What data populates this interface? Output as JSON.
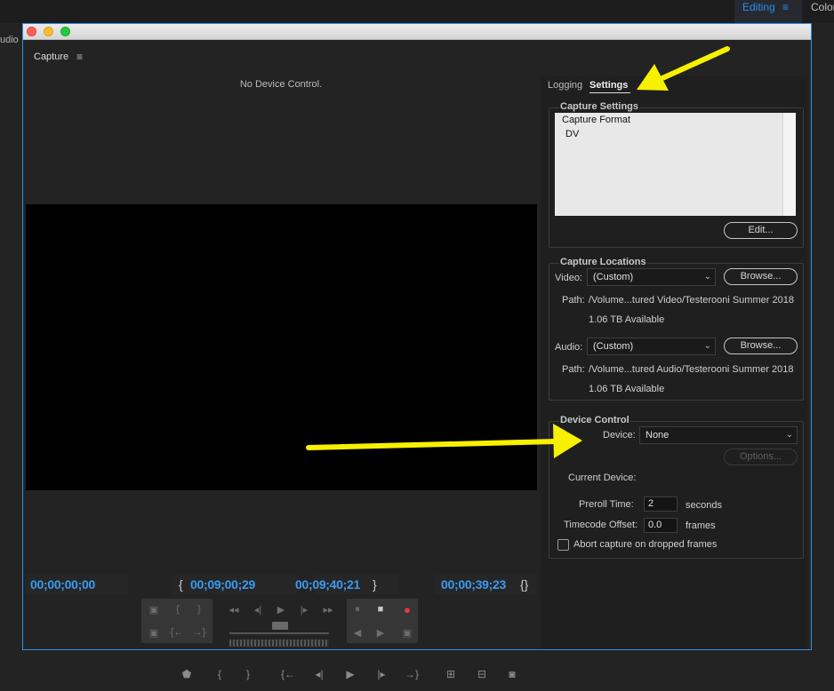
{
  "app": {
    "workspace_active": "Editing",
    "workspace_menu_icon": "≡",
    "workspace_next": "Color",
    "bg_left_label": "udio"
  },
  "panel": {
    "title": "Capture",
    "menu_icon": "≡",
    "no_device_text": "No Device Control."
  },
  "timecodes": {
    "current": "00;00;00;00",
    "in_brace": "{",
    "in_point": "00;09;00;29",
    "out_point": "00;09;40;21",
    "out_brace": "}",
    "duration": "00;00;39;23",
    "duration_brace": "{}"
  },
  "transport": {
    "group1": [
      "▣",
      "{",
      "}",
      "▣",
      "{←",
      "→}"
    ],
    "group2": [
      "◂◂",
      "◂|",
      "▶",
      "|▸",
      "▸▸"
    ],
    "group3": [
      "⏸",
      "■",
      "●",
      "◀",
      "▶",
      "▣"
    ],
    "record_color": "#e83a3a"
  },
  "tabs": {
    "logging": "Logging",
    "settings": "Settings"
  },
  "capture_settings": {
    "legend": "Capture Settings",
    "format_label": "Capture Format",
    "format_value": "DV",
    "edit_button": "Edit..."
  },
  "capture_locations": {
    "legend": "Capture Locations",
    "video_label": "Video:",
    "video_value": "(Custom)",
    "video_browse": "Browse...",
    "video_path_label": "Path:",
    "video_path": "/Volume...tured Video/Testerooni Summer 2018",
    "video_available": "1.06 TB Available",
    "audio_label": "Audio:",
    "audio_value": "(Custom)",
    "audio_browse": "Browse...",
    "audio_path_label": "Path:",
    "audio_path": "/Volume...tured Audio/Testerooni Summer 2018",
    "audio_available": "1.06 TB Available"
  },
  "device_control": {
    "legend": "Device Control",
    "device_label": "Device:",
    "device_value": "None",
    "options_button": "Options...",
    "current_device_label": "Current Device:",
    "preroll_label": "Preroll Time:",
    "preroll_value": "2",
    "preroll_unit": "seconds",
    "timecode_offset_label": "Timecode Offset:",
    "timecode_offset_value": "0.0",
    "timecode_offset_unit": "frames",
    "abort_label": "Abort capture on dropped frames"
  },
  "bottom_toolbar": [
    "⬟",
    "{",
    "}",
    "{←",
    "◂|",
    "▶",
    "|▸",
    "→}",
    "⊞",
    "⊟",
    "◙"
  ],
  "colors": {
    "accent": "#2f8ee8",
    "timecode": "#3a9bf0",
    "annotation_arrow": "#f7f000"
  }
}
